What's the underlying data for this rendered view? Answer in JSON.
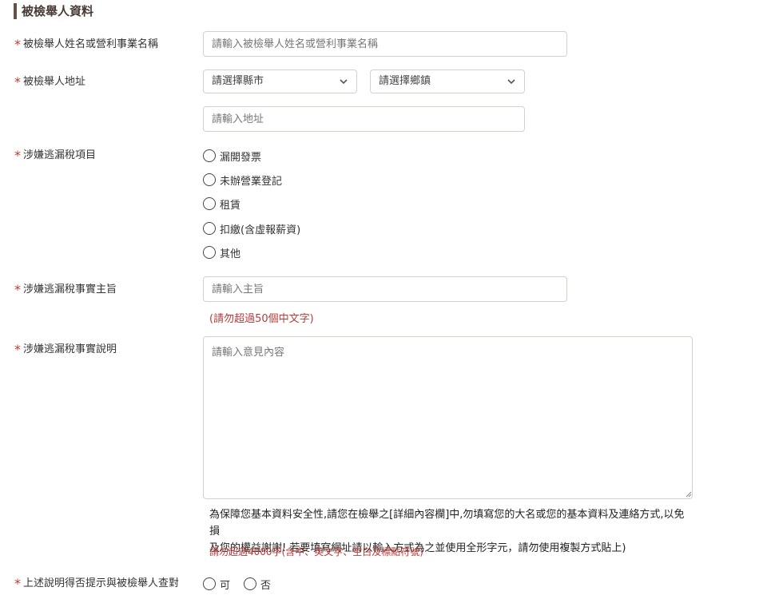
{
  "section": {
    "title": "被檢舉人資料"
  },
  "fields": {
    "name": {
      "label": "被檢舉人姓名或營利事業名稱",
      "placeholder": "請輸入被檢舉人姓名或營利事業名稱"
    },
    "address": {
      "label": "被檢舉人地址",
      "county_placeholder": "請選擇縣市",
      "town_placeholder": "請選擇鄉鎮",
      "address_placeholder": "請輸入地址"
    },
    "tax_items": {
      "label": "涉嫌逃漏稅項目",
      "options": [
        "漏開發票",
        "未辦營業登記",
        "租賃",
        "扣繳(含虛報薪資)",
        "其他"
      ]
    },
    "subject": {
      "label": "涉嫌逃漏稅事實主旨",
      "placeholder": "請輸入主旨",
      "limit_hint": "(請勿超過50個中文字)"
    },
    "description": {
      "label": "涉嫌逃漏稅事實說明",
      "placeholder": "請輸入意見內容",
      "note_line1": "為保障您基本資料安全性,請您在檢舉之[詳細內容欄]中,勿填寫您的大名或您的基本資料及連絡方式,以免損",
      "note_line2": "及您的權益謝謝! 若要填寫網址請以輸入方式為之並使用全形字元，請勿使用複製方式貼上)",
      "limit_hint": "請勿超過4000字(含中、英文字、空白及標點符號)"
    },
    "verify": {
      "label": "上述說明得否提示與被檢舉人查對",
      "yes": "可",
      "no": "否"
    }
  },
  "colors": {
    "required_star": "#c0392b",
    "accent_bar": "#6b4f46",
    "hint_red": "#b83a3a",
    "border": "#d6d1c8"
  },
  "icons": {
    "dropdown": "chevron-down-icon",
    "radio": "radio-circle",
    "required": "asterisk"
  }
}
